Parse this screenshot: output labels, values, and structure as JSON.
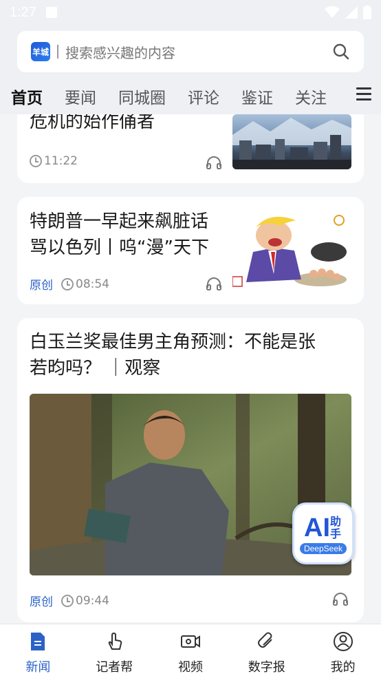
{
  "status_bar": {
    "time": "1:27"
  },
  "search": {
    "logo_text": "羊城",
    "placeholder": "搜索感兴趣的内容"
  },
  "tabs": [
    {
      "label": "首页",
      "active": true
    },
    {
      "label": "要闻",
      "active": false
    },
    {
      "label": "同城圈",
      "active": false
    },
    {
      "label": "评论",
      "active": false
    },
    {
      "label": "鉴证",
      "active": false
    },
    {
      "label": "关注",
      "active": false
    }
  ],
  "articles": [
    {
      "title": "危机的始作俑者",
      "tag": "",
      "time": "11:22"
    },
    {
      "title_line1": "特朗普一早起来飙脏话",
      "title_line2": "骂以色列丨呜“漫”天下",
      "tag": "原创",
      "time": "08:54"
    },
    {
      "title_line1": "白玉兰奖最佳男主角预测：不能是张",
      "title_line2": "若昀吗？ ｜观察",
      "tag": "原创",
      "time": "09:44"
    }
  ],
  "ai_badge": {
    "text": "AI",
    "sub": "助手",
    "brand": "DeepSeek"
  },
  "bottom_nav": [
    {
      "label": "新闻",
      "icon": "news-icon",
      "active": true
    },
    {
      "label": "记者帮",
      "icon": "hand-tap-icon",
      "active": false
    },
    {
      "label": "视频",
      "icon": "video-icon",
      "active": false
    },
    {
      "label": "数字报",
      "icon": "paperclip-icon",
      "active": false
    },
    {
      "label": "我的",
      "icon": "user-icon",
      "active": false
    }
  ],
  "colors": {
    "accent": "#2b62c8",
    "background": "#f3f4f6",
    "header": "#eef0f4"
  }
}
